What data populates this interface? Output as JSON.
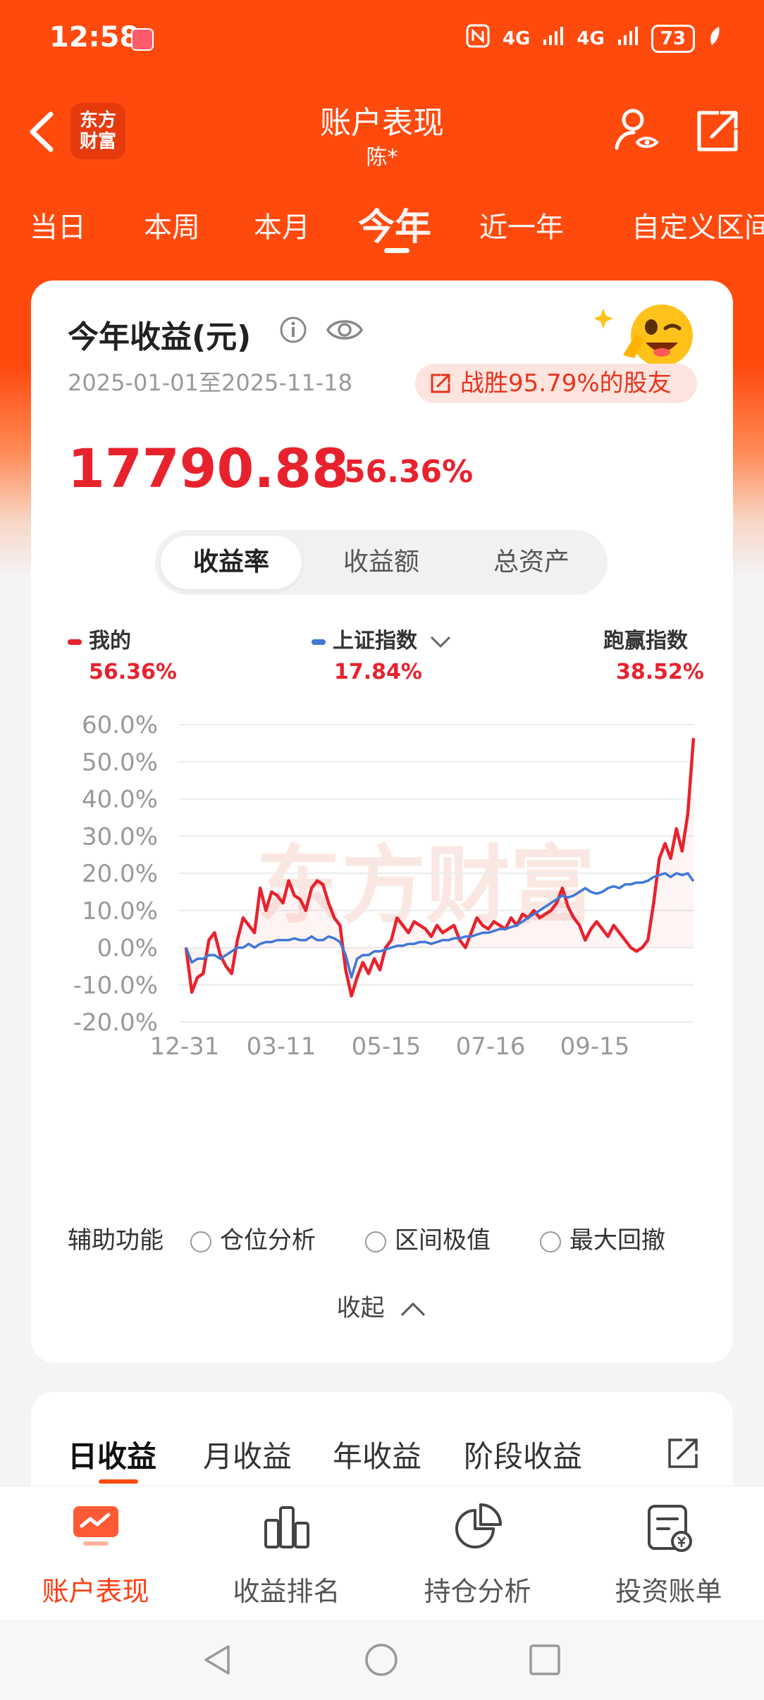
{
  "status_bar": {
    "time": "12:58",
    "network1": "4G",
    "network2": "4G",
    "battery": "73"
  },
  "header": {
    "title": "账户表现",
    "subtitle": "陈*",
    "logo_line1": "东方",
    "logo_line2": "财富"
  },
  "period_tabs": [
    "当日",
    "本周",
    "本月",
    "今年",
    "近一年",
    "自定义区间"
  ],
  "active_period": "今年",
  "summary": {
    "title": "今年收益(元)",
    "date_range": "2025-01-01至2025-11-18",
    "beat_text": "战胜95.79%的股友",
    "amount": "17790.88",
    "return_pct": "56.36%"
  },
  "segments": [
    "收益率",
    "收益额",
    "总资产"
  ],
  "active_segment": "收益率",
  "legend": [
    {
      "name": "我的",
      "value": "56.36%",
      "color": "#e8222d"
    },
    {
      "name": "上证指数",
      "value": "17.84%",
      "color": "#3f78d8"
    },
    {
      "name": "跑赢指数",
      "value": "38.52%"
    }
  ],
  "chart_data": {
    "type": "line",
    "ylim": [
      -20,
      60
    ],
    "y_ticks": [
      "60.0%",
      "50.0%",
      "40.0%",
      "30.0%",
      "20.0%",
      "10.0%",
      "0.0%",
      "-10.0%",
      "-20.0%"
    ],
    "x_ticks": [
      "12-31",
      "03-11",
      "05-15",
      "07-16",
      "09-15"
    ],
    "watermark": "东方财富",
    "series": [
      {
        "name": "我的",
        "color": "#e8222d",
        "values": [
          0.0,
          -12.0,
          -8.0,
          -7.0,
          2.0,
          4.0,
          -2.0,
          -5.0,
          -7.0,
          2.0,
          8.0,
          6.0,
          4.0,
          16.0,
          10.0,
          15.0,
          14.0,
          12.0,
          18.0,
          14.0,
          13.0,
          10.0,
          16.0,
          18.0,
          17.0,
          12.0,
          8.0,
          6.0,
          -6.0,
          -13.0,
          -8.0,
          -4.0,
          -7.0,
          -3.0,
          -6.0,
          0.0,
          2.0,
          8.0,
          6.0,
          4.0,
          7.0,
          6.0,
          5.0,
          3.0,
          6.0,
          4.0,
          5.0,
          6.0,
          2.0,
          0.0,
          4.0,
          8.0,
          6.0,
          5.0,
          7.0,
          6.0,
          5.0,
          8.0,
          6.0,
          9.0,
          8.0,
          10.0,
          8.0,
          9.0,
          10.0,
          12.0,
          16.0,
          11.0,
          8.0,
          6.0,
          2.0,
          5.0,
          7.0,
          5.0,
          3.0,
          6.0,
          4.0,
          2.0,
          0.0,
          -1.0,
          0.0,
          2.0,
          12.0,
          24.0,
          28.0,
          24.0,
          32.0,
          26.0,
          36.0,
          56.36
        ],
        "x_ticks_labeled": true
      },
      {
        "name": "上证指数",
        "color": "#3f78d8",
        "values": [
          0.0,
          -4.0,
          -3.0,
          -3.0,
          -2.0,
          -2.0,
          -3.0,
          -2.0,
          -1.0,
          0.0,
          0.0,
          1.0,
          0.0,
          1.0,
          1.5,
          1.5,
          2.0,
          2.0,
          2.0,
          2.5,
          2.0,
          2.0,
          3.0,
          2.0,
          2.0,
          3.0,
          2.5,
          1.5,
          -2.0,
          -8.0,
          -3.0,
          -2.0,
          -2.0,
          -1.0,
          -1.0,
          -0.5,
          0.0,
          0.5,
          0.5,
          1.0,
          1.0,
          1.5,
          1.5,
          1.0,
          1.5,
          2.0,
          2.0,
          2.5,
          2.5,
          3.0,
          3.0,
          3.5,
          4.0,
          4.0,
          4.5,
          5.0,
          5.0,
          5.5,
          6.0,
          7.0,
          8.0,
          9.0,
          10.0,
          11.0,
          12.0,
          13.0,
          14.0,
          13.5,
          14.0,
          15.0,
          16.0,
          15.0,
          14.5,
          15.0,
          16.0,
          16.5,
          16.0,
          17.0,
          17.0,
          17.5,
          17.5,
          18.0,
          19.0,
          19.5,
          20.0,
          19.0,
          20.0,
          19.5,
          20.0,
          17.84
        ]
      }
    ]
  },
  "aux": {
    "label": "辅助功能",
    "options": [
      "仓位分析",
      "区间极值",
      "最大回撤"
    ]
  },
  "collapse_label": "收起",
  "profit_tabs": [
    "日收益",
    "月收益",
    "年收益",
    "阶段收益"
  ],
  "active_profit_tab": "日收益",
  "bottom_nav": [
    {
      "label": "账户表现",
      "icon": "chart-screen-icon"
    },
    {
      "label": "收益排名",
      "icon": "bar-rank-icon"
    },
    {
      "label": "持仓分析",
      "icon": "pie-icon"
    },
    {
      "label": "投资账单",
      "icon": "bill-icon"
    }
  ],
  "accent_color": "#ff4a0e"
}
